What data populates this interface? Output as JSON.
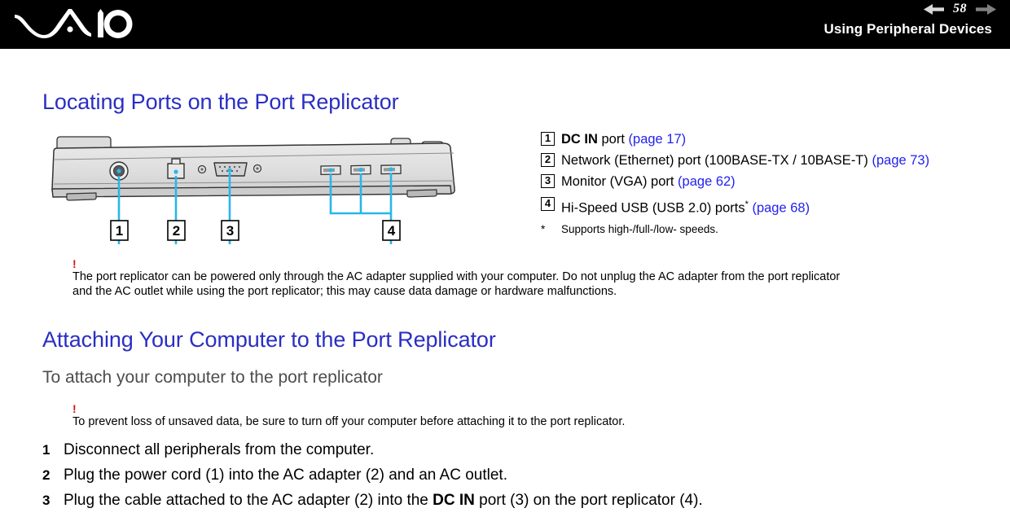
{
  "header": {
    "logo_name": "vaio-logo",
    "page_number": "58",
    "title": "Using Peripheral Devices",
    "prev_arrow": "prev-page-arrow",
    "next_arrow": "next-page-arrow"
  },
  "colors": {
    "heading_blue": "#2a2ec2",
    "link_blue": "#2222ee",
    "callout_cyan": "#29b6ea",
    "warning_red": "#d81010",
    "header_black": "#000000",
    "device_gray": "#dcdcdc"
  },
  "sections": {
    "heading_locating": "Locating Ports on the Port Replicator",
    "heading_attaching": "Attaching Your Computer to the Port Replicator",
    "subhead_attach": "To attach your computer to the port replicator"
  },
  "figure": {
    "name": "port-replicator-rear-diagram",
    "callouts": [
      {
        "num": "1",
        "port": "dc-in-jack"
      },
      {
        "num": "2",
        "port": "ethernet-rj45-port"
      },
      {
        "num": "3",
        "port": "vga-dsub-port"
      },
      {
        "num": "4",
        "port": "usb-ports-group"
      }
    ]
  },
  "legend": {
    "items": [
      {
        "num": "1",
        "bold": "DC IN",
        "text": " port ",
        "link": "(page 17)"
      },
      {
        "num": "2",
        "bold": "",
        "text": "Network (Ethernet) port (100BASE-TX / 10BASE-T) ",
        "link": "(page 73)"
      },
      {
        "num": "3",
        "bold": "",
        "text": "Monitor (VGA) port ",
        "link": "(page 62)"
      },
      {
        "num": "4",
        "bold": "",
        "text": "Hi-Speed USB (USB 2.0) ports",
        "sup": "*",
        "link": " (page 68)"
      }
    ],
    "footnote_marker": "*",
    "footnote_text": "Supports high-/full-/low- speeds."
  },
  "notes": {
    "note1_marker": "!",
    "note1_line1": "The port replicator can be powered only through the AC adapter supplied with your computer. Do not unplug the AC adapter from the port replicator",
    "note1_line2": "and the AC outlet while using the port replicator; this may cause data damage or hardware malfunctions.",
    "note2_marker": "!",
    "note2_line1": "To prevent loss of unsaved data, be sure to turn off your computer before attaching it to the port replicator."
  },
  "steps": [
    {
      "num": "1",
      "pre": "Disconnect all peripherals from the computer.",
      "bold": "",
      "post": ""
    },
    {
      "num": "2",
      "pre": "Plug the power cord (1) into the AC adapter (2) and an AC outlet.",
      "bold": "",
      "post": ""
    },
    {
      "num": "3",
      "pre": "Plug the cable attached to the AC adapter (2) into the ",
      "bold": "DC IN",
      "post": " port (3) on the port replicator (4)."
    }
  ]
}
